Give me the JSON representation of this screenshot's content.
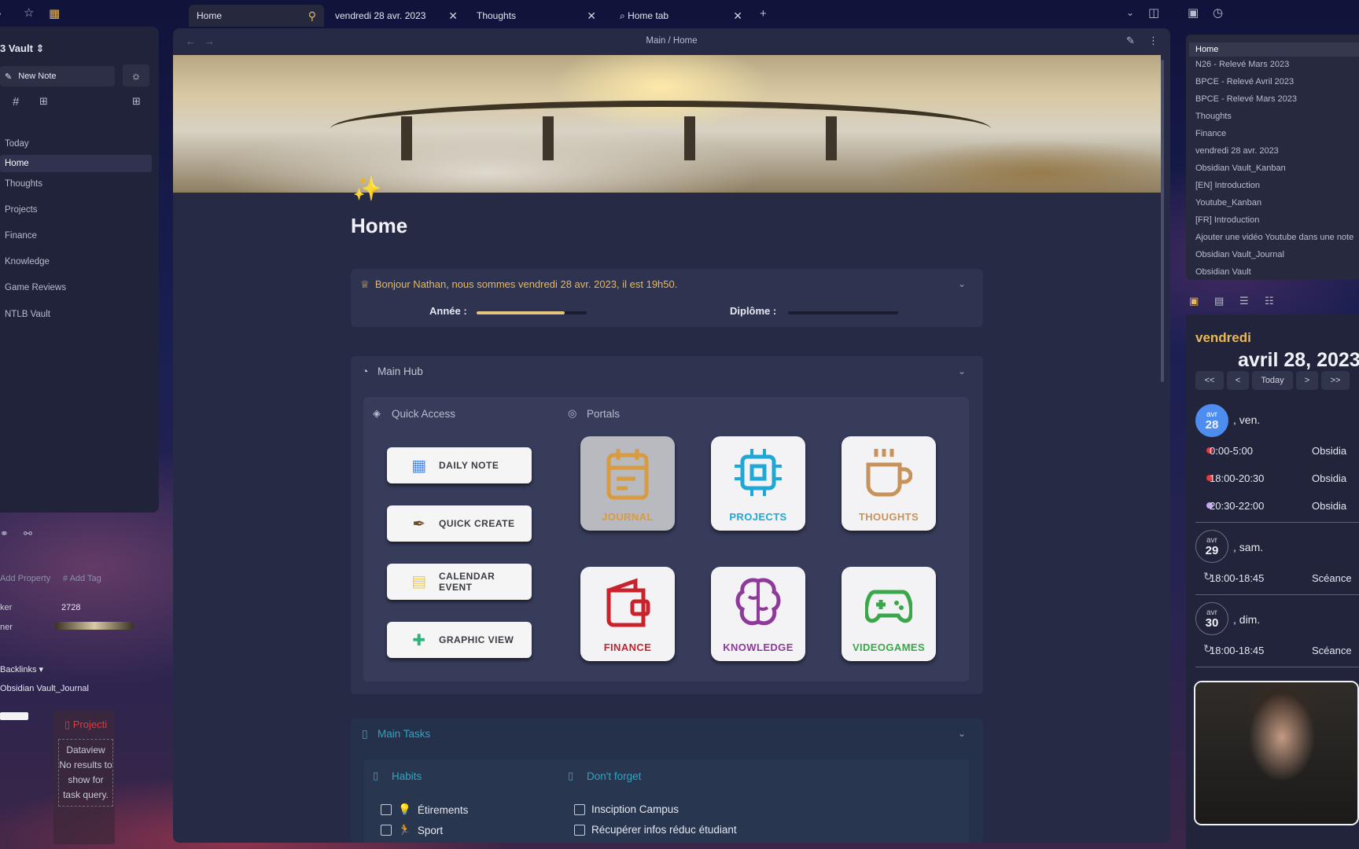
{
  "tabs": [
    {
      "label": "Home",
      "active": true
    },
    {
      "label": "vendredi 28 avr. 2023",
      "active": false
    },
    {
      "label": "Thoughts",
      "active": false
    },
    {
      "label": "Home tab",
      "active": false
    }
  ],
  "breadcrumb": "Main / Home",
  "left": {
    "vault_name": "3 Vault",
    "new_note": "New Note",
    "nav": [
      "Today",
      "Home",
      "Thoughts",
      "Projects",
      "Finance",
      "Knowledge",
      "Game Reviews",
      "NTLB Vault"
    ],
    "add_property": "Add Property",
    "add_tag": "Add Tag",
    "prop1_key": "ker",
    "prop1_val": "2728",
    "prop2_key": "ner",
    "backlinks": "Backlinks",
    "backlink_item": "Obsidian Vault_Journal",
    "projects_label": "Projecti",
    "dataview_msg": "Dataview No results to show for task query."
  },
  "page": {
    "title": "Home",
    "greeting": "Bonjour Nathan, nous sommes vendredi 28 avr. 2023, il est 19h50.",
    "annee_label": "Année :",
    "annee_progress": 0.8,
    "diplome_label": "Diplôme :",
    "diplome_progress": 0.0,
    "main_hub": "Main Hub",
    "quick_access": "Quick Access",
    "portals": "Portals",
    "quick_buttons": [
      "DAILY NOTE",
      "QUICK CREATE",
      "CALENDAR EVENT",
      "GRAPHIC VIEW"
    ],
    "portal_items": [
      {
        "label": "JOURNAL",
        "color": "#d99b3f"
      },
      {
        "label": "PROJECTS",
        "color": "#1fa8d6"
      },
      {
        "label": "THOUGHTS",
        "color": "#c8935a"
      },
      {
        "label": "FINANCE",
        "color": "#c8232c"
      },
      {
        "label": "KNOWLEDGE",
        "color": "#8e3a9b"
      },
      {
        "label": "VIDEOGAMES",
        "color": "#3aa84a"
      }
    ],
    "main_tasks": "Main Tasks",
    "habits": "Habits",
    "dont_forget": "Don't forget",
    "habit_items": [
      "Étirements",
      "Sport"
    ],
    "forget_items": [
      "Insciption Campus",
      "Récupérer infos réduc étudiant"
    ]
  },
  "recent": [
    "Home",
    "N26 - Relevé Mars 2023",
    "BPCE - Relevé Avril 2023",
    "BPCE - Relevé Mars 2023",
    "Thoughts",
    "Finance",
    "vendredi 28 avr. 2023",
    "Obsidian Vault_Kanban",
    "[EN] Introduction",
    "Youtube_Kanban",
    "[FR] Introduction",
    "Ajouter une vidéo Youtube dans une note",
    "Obsidian Vault_Journal",
    "Obsidian Vault"
  ],
  "calendar": {
    "weekday": "vendredi",
    "date": "avril 28, 2023",
    "controls": [
      "<<",
      "<",
      "Today",
      ">",
      ">>"
    ],
    "days": [
      {
        "month": "avr",
        "day": "28",
        "label": ", ven.",
        "events": [
          {
            "time": "0:00-5:00",
            "title": "Obsidia",
            "color": "#e23b3b"
          },
          {
            "time": "18:00-20:30",
            "title": "Obsidia",
            "color": "#e23b3b"
          },
          {
            "time": "20:30-22:00",
            "title": "Obsidia",
            "color": "#c5a6f0"
          }
        ]
      },
      {
        "month": "avr",
        "day": "29",
        "label": ", sam.",
        "events": [
          {
            "time": "18:00-18:45",
            "title": "Scéance"
          }
        ]
      },
      {
        "month": "avr",
        "day": "30",
        "label": ", dim.",
        "events": [
          {
            "time": "18:00-18:45",
            "title": "Scéance"
          }
        ]
      }
    ]
  },
  "colors": {
    "accent": "#e8b85c",
    "today_circle": "#4e8df0",
    "tasks_accent": "#2aa7c4"
  }
}
